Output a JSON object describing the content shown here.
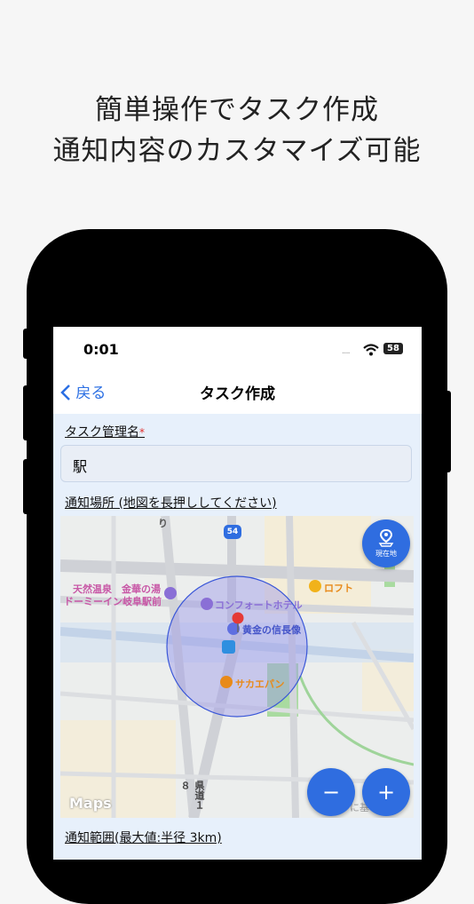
{
  "headline": {
    "line1": "簡単操作でタスク作成",
    "line2": "通知内容のカスタマイズ可能"
  },
  "status_bar": {
    "time": "0:01",
    "signal": "....",
    "battery": "58"
  },
  "nav": {
    "back_label": "戻る",
    "title": "タスク作成"
  },
  "task_name": {
    "label": "タスク管理名",
    "required_mark": "*",
    "value": "駅"
  },
  "location": {
    "label": "通知場所 (地図を長押ししてください)",
    "route_number": "54",
    "pois": [
      "天然温泉　金華の湯",
      "ドーミーイン岐阜駅前",
      "コンフォートホテル",
      "黄金の信長像",
      "サカエパン",
      "ロフト",
      "り",
      "県道１８",
      "に基"
    ],
    "current_location_label": "現在地",
    "zoom_out_label": "−",
    "zoom_in_label": "+",
    "attribution": "Maps"
  },
  "range": {
    "label": "通知範囲(最大値:半径 3km)"
  },
  "colors": {
    "accent": "#2f6de0",
    "form_bg": "#e7f0fb",
    "required": "#e0302e",
    "poi_purple": "#8a6fd6",
    "poi_orange": "#e88a1a"
  }
}
